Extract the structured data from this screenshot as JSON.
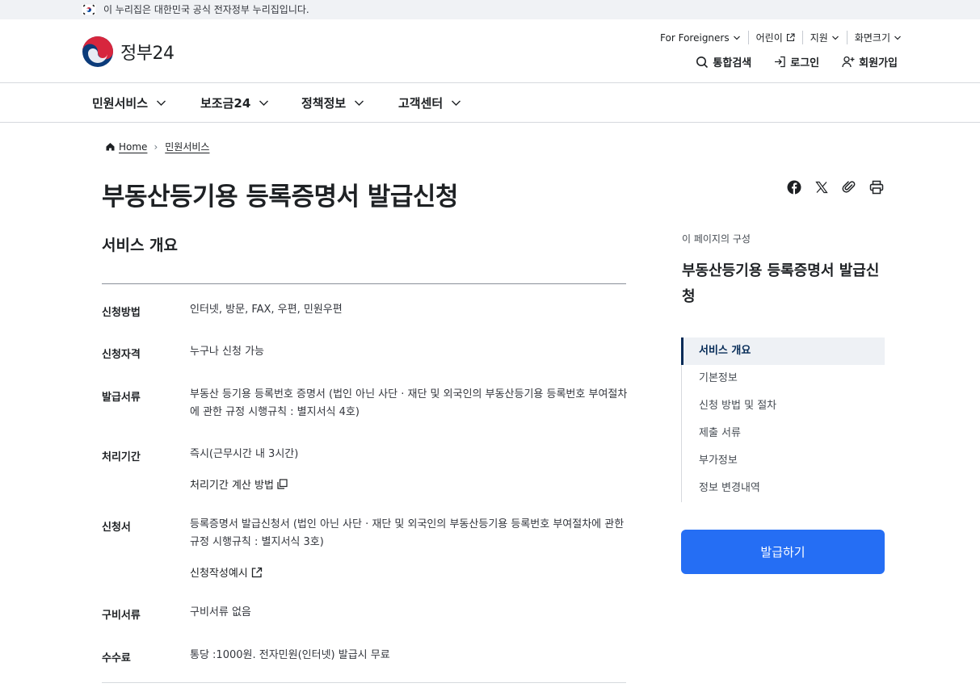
{
  "top_notice": {
    "flag_icon": "korea-flag-icon",
    "text": "이 누리집은 대한민국 공식 전자정부 누리집입니다."
  },
  "header": {
    "logo_text": "정부24",
    "utility": [
      {
        "label": "For Foreigners",
        "icon": "chevron-down-icon"
      },
      {
        "label": "어린이",
        "icon": "external-link-icon"
      },
      {
        "label": "지원",
        "icon": "chevron-down-icon"
      },
      {
        "label": "화면크기",
        "icon": "chevron-down-icon"
      }
    ],
    "actions": [
      {
        "label": "통합검색",
        "icon": "search-icon"
      },
      {
        "label": "로그인",
        "icon": "login-icon"
      },
      {
        "label": "회원가입",
        "icon": "user-plus-icon"
      }
    ]
  },
  "nav": {
    "items": [
      "민원서비스",
      "보조금24",
      "정책정보",
      "고객센터"
    ]
  },
  "breadcrumb": {
    "home": "Home",
    "current": "민원서비스"
  },
  "page": {
    "title": "부동산등기용 등록증명서 발급신청",
    "section_title": "서비스 개요"
  },
  "share_icons": [
    "facebook-icon",
    "x-icon",
    "link-icon",
    "print-icon"
  ],
  "overview": {
    "method": {
      "label": "신청방법",
      "value": "인터넷, 방문, FAX, 우편, 민원우편"
    },
    "eligibility": {
      "label": "신청자격",
      "value": "누구나 신청 가능"
    },
    "document": {
      "label": "발급서류",
      "value": "부동산 등기용 등록번호 증명서 (법인 아닌 사단 · 재단 및 외국인의 부동산등기용 등록번호 부여절차에 관한 규정 시행규칙 : 별지서식 4호)"
    },
    "period": {
      "label": "처리기간",
      "value": "즉시(근무시간 내 3시간)",
      "link": "처리기간 계산 방법"
    },
    "form": {
      "label": "신청서",
      "value": "등록증명서 발급신청서 (법인 아닌 사단 · 재단 및 외국인의 부동산등기용 등록번호 부여절차에 관한 규정 시행규칙 : 별지서식 3호)",
      "link": "신청작성예시"
    },
    "required": {
      "label": "구비서류",
      "value": "구비서류 없음"
    },
    "fee": {
      "label": "수수료",
      "value": "통당 :1000원. 전자민원(인터넷) 발급시 무료"
    }
  },
  "toc": {
    "caption": "이 페이지의 구성",
    "title": "부동산등기용 등록증명서 발급신청",
    "items": [
      "서비스 개요",
      "기본정보",
      "신청 방법 및 절차",
      "제출 서류",
      "부가정보",
      "정보 변경내역"
    ],
    "active_index": 0
  },
  "issue_button": "발급하기",
  "colors": {
    "primary": "#256ef4",
    "navy": "#052b57",
    "text": "#1e2124"
  }
}
